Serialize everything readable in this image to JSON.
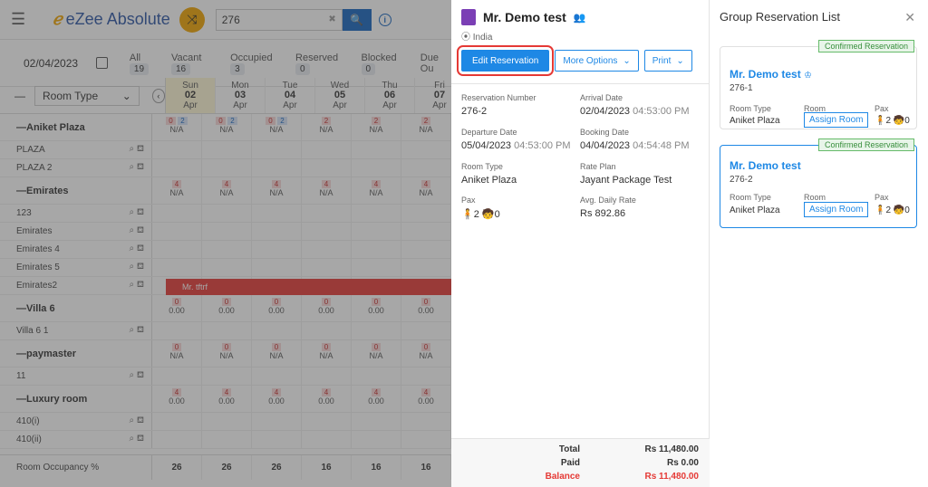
{
  "topbar": {
    "app_name": "eZee Absolute",
    "search_value": "276"
  },
  "filters": {
    "date": "02/04/2023",
    "items": [
      {
        "label": "All",
        "count": "19"
      },
      {
        "label": "Vacant",
        "count": "16"
      },
      {
        "label": "Occupied",
        "count": "3"
      },
      {
        "label": "Reserved",
        "count": "0"
      },
      {
        "label": "Blocked",
        "count": "0"
      },
      {
        "label": "Due Ou",
        "count": ""
      }
    ]
  },
  "grid": {
    "room_type_select": "Room Type",
    "days": [
      {
        "dow": "Sun",
        "day": "02",
        "mon": "Apr"
      },
      {
        "dow": "Mon",
        "day": "03",
        "mon": "Apr"
      },
      {
        "dow": "Tue",
        "day": "04",
        "mon": "Apr"
      },
      {
        "dow": "Wed",
        "day": "05",
        "mon": "Apr"
      },
      {
        "dow": "Thu",
        "day": "06",
        "mon": "Apr"
      },
      {
        "dow": "Fri",
        "day": "07",
        "mon": "Apr"
      }
    ],
    "rows": [
      {
        "type": "group",
        "label": "Aniket Plaza",
        "cells": [
          [
            "0",
            "2",
            "N/A"
          ],
          [
            "0",
            "2",
            "N/A"
          ],
          [
            "0",
            "2",
            "N/A"
          ],
          [
            "2",
            "",
            "N/A"
          ],
          [
            "2",
            "",
            "N/A"
          ],
          [
            "2",
            "",
            "N/A"
          ]
        ]
      },
      {
        "type": "room",
        "label": "PLAZA"
      },
      {
        "type": "room",
        "label": "PLAZA 2"
      },
      {
        "type": "group",
        "label": "Emirates",
        "cells": [
          [
            "4",
            "",
            "N/A"
          ],
          [
            "4",
            "",
            "N/A"
          ],
          [
            "4",
            "",
            "N/A"
          ],
          [
            "4",
            "",
            "N/A"
          ],
          [
            "4",
            "",
            "N/A"
          ],
          [
            "4",
            "",
            "N/A"
          ]
        ]
      },
      {
        "type": "room",
        "label": "123"
      },
      {
        "type": "room",
        "label": "Emirates"
      },
      {
        "type": "room",
        "label": "Emirates 4"
      },
      {
        "type": "room",
        "label": "Emirates 5"
      },
      {
        "type": "room",
        "label": "Emirates2"
      },
      {
        "type": "group",
        "label": "Villa 6",
        "cells": [
          [
            "0",
            "",
            "0.00"
          ],
          [
            "0",
            "",
            "0.00"
          ],
          [
            "0",
            "",
            "0.00"
          ],
          [
            "0",
            "",
            "0.00"
          ],
          [
            "0",
            "",
            "0.00"
          ],
          [
            "0",
            "",
            "0.00"
          ]
        ]
      },
      {
        "type": "room",
        "label": "Villa 6 1"
      },
      {
        "type": "group",
        "label": "paymaster",
        "cells": [
          [
            "0",
            "",
            "N/A"
          ],
          [
            "0",
            "",
            "N/A"
          ],
          [
            "0",
            "",
            "N/A"
          ],
          [
            "0",
            "",
            "N/A"
          ],
          [
            "0",
            "",
            "N/A"
          ],
          [
            "0",
            "",
            "N/A"
          ]
        ]
      },
      {
        "type": "room",
        "label": "11"
      },
      {
        "type": "group",
        "label": "Luxury room",
        "cells": [
          [
            "4",
            "",
            "0.00"
          ],
          [
            "4",
            "",
            "0.00"
          ],
          [
            "4",
            "",
            "0.00"
          ],
          [
            "4",
            "",
            "0.00"
          ],
          [
            "4",
            "",
            "0.00"
          ],
          [
            "4",
            "",
            "0.00"
          ]
        ]
      },
      {
        "type": "room",
        "label": "410(i)"
      },
      {
        "type": "room",
        "label": "410(ii)"
      }
    ],
    "res_bar_label": "Mr. tftrf",
    "occupancy_label": "Room Occupancy %",
    "occupancy": [
      "26",
      "26",
      "26",
      "16",
      "16",
      "16"
    ]
  },
  "panel": {
    "guest_name": "Mr. Demo test",
    "country": "India",
    "edit_btn": "Edit Reservation",
    "more_btn": "More Options",
    "print_btn": "Print",
    "fields": {
      "res_no_label": "Reservation Number",
      "res_no": "276-2",
      "arrival_label": "Arrival Date",
      "arrival_date": "02/04/2023",
      "arrival_time": "04:53:00 PM",
      "departure_label": "Departure Date",
      "departure_date": "05/04/2023",
      "departure_time": "04:53:00 PM",
      "booking_label": "Booking Date",
      "booking_date": "04/04/2023",
      "booking_time": "04:54:48 PM",
      "room_type_label": "Room Type",
      "room_type": "Aniket Plaza",
      "rate_plan_label": "Rate Plan",
      "rate_plan": "Jayant Package Test",
      "pax_label": "Pax",
      "pax": "🧍2 🧒0",
      "adr_label": "Avg. Daily Rate",
      "adr": "Rs 892.86"
    },
    "totals": {
      "total_label": "Total",
      "total": "Rs 11,480.00",
      "paid_label": "Paid",
      "paid": "Rs 0.00",
      "balance_label": "Balance",
      "balance": "Rs 11,480.00"
    }
  },
  "group_list": {
    "title": "Group Reservation List",
    "cards": [
      {
        "badge": "Confirmed Reservation",
        "name": "Mr. Demo test",
        "number": "276-1",
        "room_type_label": "Room Type",
        "room_label": "Room",
        "pax_label": "Pax",
        "room_type": "Aniket Plaza",
        "assign": "Assign Room",
        "pax": "🧍2 🧒0"
      },
      {
        "badge": "Confirmed Reservation",
        "name": "Mr. Demo test",
        "number": "276-2",
        "room_type_label": "Room Type",
        "room_label": "Room",
        "pax_label": "Pax",
        "room_type": "Aniket Plaza",
        "assign": "Assign Room",
        "pax": "🧍2 🧒0"
      }
    ]
  },
  "colors": {
    "accent": "#1e88e5",
    "brand": "#2b55a5",
    "danger": "#e53935",
    "success": "#388e3c"
  }
}
